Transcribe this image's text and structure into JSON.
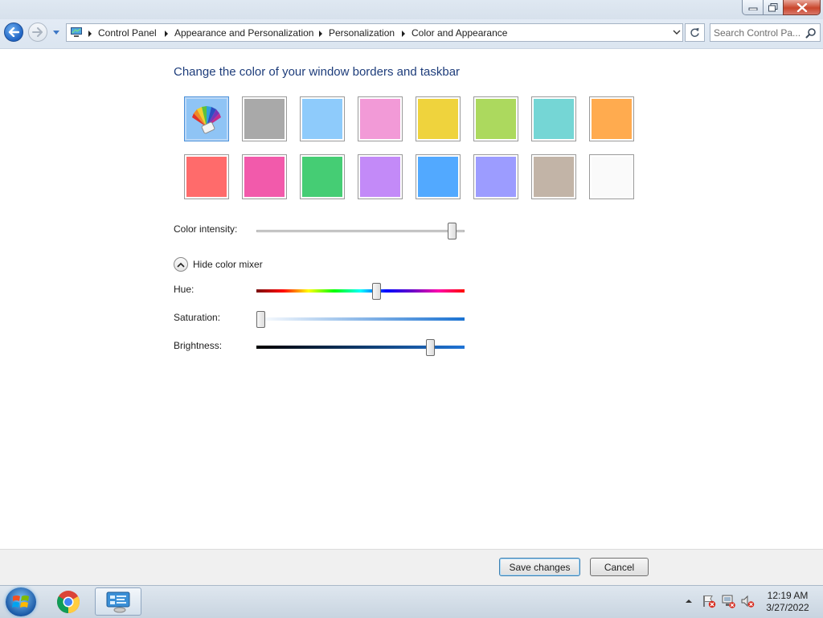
{
  "window": {
    "controls": {
      "minimize_icon": "minimize-icon",
      "maximize_icon": "restore-icon",
      "close_icon": "close-icon"
    }
  },
  "navigation": {
    "breadcrumbs": [
      "Control Panel",
      "Appearance and Personalization",
      "Personalization",
      "Color and Appearance"
    ],
    "search_placeholder": "Search Control Pa..."
  },
  "content": {
    "heading": "Change the color of your window borders and taskbar",
    "swatches": [
      {
        "name": "custom",
        "color": "#8fc4f5",
        "selected": true
      },
      {
        "name": "slate",
        "color": "#a9a9a9"
      },
      {
        "name": "sky",
        "color": "#8ecbfb"
      },
      {
        "name": "twilight-pink",
        "color": "#f29ad7"
      },
      {
        "name": "sun",
        "color": "#efd33d"
      },
      {
        "name": "leaf",
        "color": "#acd95e"
      },
      {
        "name": "sea-foam",
        "color": "#75d6d5"
      },
      {
        "name": "pumpkin",
        "color": "#ffab4f"
      },
      {
        "name": "blush",
        "color": "#ff6b6b"
      },
      {
        "name": "fuchsia",
        "color": "#f25aab"
      },
      {
        "name": "lime",
        "color": "#45cd74"
      },
      {
        "name": "lavender",
        "color": "#c38af8"
      },
      {
        "name": "sky-blue",
        "color": "#52a9ff"
      },
      {
        "name": "violet",
        "color": "#9c9cff"
      },
      {
        "name": "chocolate",
        "color": "#c2b4a7"
      },
      {
        "name": "frost",
        "color": "#fafafa"
      }
    ],
    "color_intensity": {
      "label": "Color intensity:",
      "value": 0.96
    },
    "mixer_toggle_label": "Hide color mixer",
    "hue": {
      "label": "Hue:",
      "value": 0.58
    },
    "saturation": {
      "label": "Saturation:",
      "value": 0.0
    },
    "brightness": {
      "label": "Brightness:",
      "value": 0.85
    }
  },
  "buttons": {
    "save": "Save changes",
    "cancel": "Cancel"
  },
  "taskbar": {
    "items": [
      "start-orb-icon",
      "chrome-icon",
      "control-panel-icon"
    ],
    "tray_icons": [
      "show-hidden-icons-icon",
      "action-center-flag-icon",
      "network-icon",
      "volume-muted-icon"
    ],
    "time": "12:19 AM",
    "date": "3/27/2022"
  }
}
